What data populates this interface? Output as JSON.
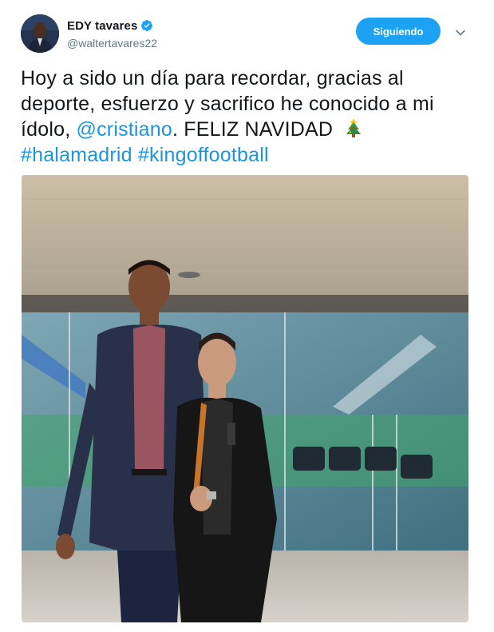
{
  "user": {
    "display_name": "EDY tavares",
    "handle": "@waltertavares22",
    "verified": true
  },
  "actions": {
    "follow_label": "Siguiendo",
    "menu_icon": "chevron-down-icon"
  },
  "tweet": {
    "text_part1": "Hoy a sido un día para recordar, gracias al deporte, esfuerzo y sacrifico he conocido a mi ídolo, ",
    "mention": "@cristiano",
    "text_part2": ". FELIZ NAVIDAD ",
    "emoji": "christmas-tree-emoji",
    "hashtag1": "#halamadrid",
    "hashtag2": "#kingoffootball"
  },
  "media": {
    "type": "photo"
  },
  "colors": {
    "accent": "#1da1f2",
    "link": "#1b95e0",
    "text": "#14171a",
    "secondary": "#657786"
  }
}
